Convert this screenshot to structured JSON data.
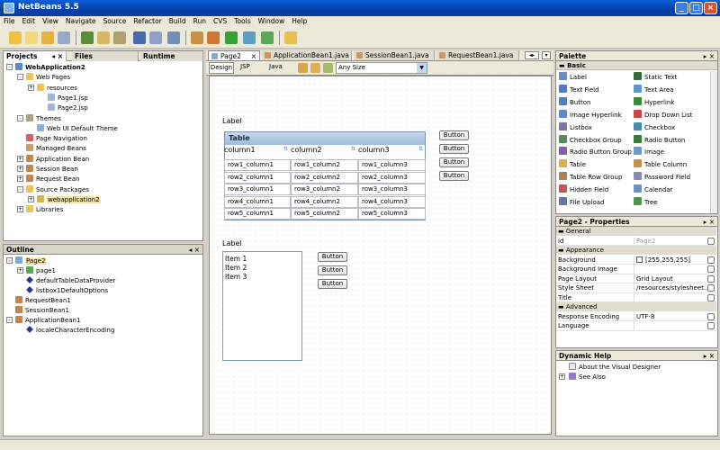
{
  "window": {
    "title": "NetBeans 5.5"
  },
  "menu": [
    "File",
    "Edit",
    "View",
    "Navigate",
    "Source",
    "Refactor",
    "Build",
    "Run",
    "CVS",
    "Tools",
    "Window",
    "Help"
  ],
  "projects": {
    "tabs": [
      "Projects",
      "Files",
      "Runtime"
    ],
    "tree": [
      {
        "label": "WebApplication2",
        "indent": 0,
        "expander": "-",
        "icon": "globe-icon",
        "bold": true
      },
      {
        "label": "Web Pages",
        "indent": 1,
        "expander": "-",
        "icon": "folder-icon"
      },
      {
        "label": "resources",
        "indent": 2,
        "expander": "+",
        "icon": "folder-icon"
      },
      {
        "label": "Page1.jsp",
        "indent": 3,
        "expander": "",
        "icon": "jsp-file-icon"
      },
      {
        "label": "Page2.jsp",
        "indent": 3,
        "expander": "",
        "icon": "jsp-file-icon"
      },
      {
        "label": "Themes",
        "indent": 1,
        "expander": "-",
        "icon": "themes-icon"
      },
      {
        "label": "Web UI Default Theme",
        "indent": 2,
        "expander": "",
        "icon": "theme-icon"
      },
      {
        "label": "Page Navigation",
        "indent": 1,
        "expander": "",
        "icon": "navigation-icon"
      },
      {
        "label": "Managed Beans",
        "indent": 1,
        "expander": "",
        "icon": "beans-icon"
      },
      {
        "label": "Application Bean",
        "indent": 1,
        "expander": "+",
        "icon": "bean-icon"
      },
      {
        "label": "Session Bean",
        "indent": 1,
        "expander": "+",
        "icon": "bean-icon"
      },
      {
        "label": "Request Bean",
        "indent": 1,
        "expander": "+",
        "icon": "bean-icon"
      },
      {
        "label": "Source Packages",
        "indent": 1,
        "expander": "-",
        "icon": "folder-icon"
      },
      {
        "label": "webapplication2",
        "indent": 2,
        "expander": "+",
        "icon": "package-icon",
        "selected": true
      },
      {
        "label": "Libraries",
        "indent": 1,
        "expander": "+",
        "icon": "folder-icon"
      }
    ]
  },
  "outline": {
    "title": "Outline",
    "tree": [
      {
        "label": "Page2",
        "indent": 0,
        "expander": "-",
        "icon": "page-icon",
        "selected": true
      },
      {
        "label": "page1",
        "indent": 1,
        "expander": "+",
        "icon": "component-icon"
      },
      {
        "label": "defaultTableDataProvider",
        "indent": 1,
        "expander": "",
        "icon": "diamond-icon"
      },
      {
        "label": "listbox1DefaultOptions",
        "indent": 1,
        "expander": "",
        "icon": "diamond-icon"
      },
      {
        "label": "RequestBean1",
        "indent": 0,
        "expander": "",
        "icon": "bean-icon"
      },
      {
        "label": "SessionBean1",
        "indent": 0,
        "expander": "",
        "icon": "bean-icon"
      },
      {
        "label": "ApplicationBean1",
        "indent": 0,
        "expander": "-",
        "icon": "bean-icon"
      },
      {
        "label": "localeCharacterEncoding",
        "indent": 1,
        "expander": "",
        "icon": "diamond-icon"
      }
    ]
  },
  "editor": {
    "tabs": [
      "Page2",
      "ApplicationBean1.java",
      "SessionBean1.java",
      "RequestBean1.java"
    ],
    "views": [
      "Design",
      "JSP",
      "Java"
    ],
    "size_select": "Any Size"
  },
  "design": {
    "label1": "Label",
    "label2": "Label",
    "table_title": "Table",
    "columns": [
      "column1",
      "column2",
      "column3"
    ],
    "rows": [
      [
        "row1_column1",
        "row1_column2",
        "row1_column3"
      ],
      [
        "row2_column1",
        "row2_column2",
        "row2_column3"
      ],
      [
        "row3_column1",
        "row3_column2",
        "row3_column3"
      ],
      [
        "row4_column1",
        "row4_column2",
        "row4_column3"
      ],
      [
        "row5_column1",
        "row5_column2",
        "row5_column3"
      ]
    ],
    "button_label": "Button",
    "listbox_items": [
      "Item 1",
      "Item 2",
      "Item 3"
    ]
  },
  "palette": {
    "title": "Palette",
    "category": "Basic",
    "items": [
      [
        "Label",
        "Static Text"
      ],
      [
        "Text Field",
        "Text Area"
      ],
      [
        "Button",
        "Hyperlink"
      ],
      [
        "Image Hyperlink",
        "Drop Down List"
      ],
      [
        "Listbox",
        "Checkbox"
      ],
      [
        "Checkbox Group",
        "Radio Button"
      ],
      [
        "Radio Button Group",
        "Image"
      ],
      [
        "Table",
        "Table Column"
      ],
      [
        "Table Row Group",
        "Password Field"
      ],
      [
        "Hidden Field",
        "Calendar"
      ],
      [
        "File Upload",
        "Tree"
      ]
    ]
  },
  "properties": {
    "title": "Page2 - Properties",
    "groups": [
      {
        "name": "General",
        "props": [
          {
            "k": "id",
            "v": "Page2",
            "gray": true
          }
        ]
      },
      {
        "name": "Appearance",
        "props": [
          {
            "k": "Background",
            "v": "[255,255,255]",
            "swatch": "#ffffff"
          },
          {
            "k": "Background Image",
            "v": ""
          },
          {
            "k": "Page Layout",
            "v": "Grid Layout"
          },
          {
            "k": "Style Sheet",
            "v": "/resources/stylesheet...."
          },
          {
            "k": "Title",
            "v": ""
          }
        ]
      },
      {
        "name": "Advanced",
        "props": [
          {
            "k": "Response Encoding",
            "v": "UTF-8"
          },
          {
            "k": "Language",
            "v": ""
          }
        ]
      }
    ]
  },
  "dynamic_help": {
    "title": "Dynamic Help",
    "items": [
      "About the Visual Designer",
      "See Also"
    ]
  }
}
